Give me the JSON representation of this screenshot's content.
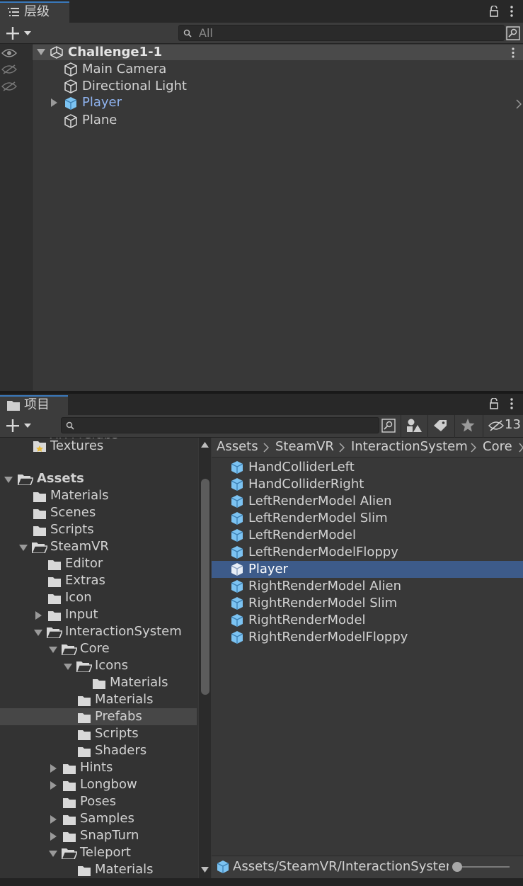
{
  "hierarchy": {
    "tab_label": "层级",
    "search_placeholder": "All",
    "scene_name": "Challenge1-1",
    "items": [
      {
        "label": "Main Camera",
        "prefab": false
      },
      {
        "label": "Directional Light",
        "prefab": false
      },
      {
        "label": "Player",
        "prefab": true
      },
      {
        "label": "Plane",
        "prefab": false
      }
    ]
  },
  "project": {
    "tab_label": "项目",
    "search_placeholder": "",
    "hidden_count": "13",
    "partial_top_label": "XR Prefabs",
    "tree": [
      {
        "label": "Textures"
      },
      {
        "label": "Assets"
      },
      {
        "label": "Materials"
      },
      {
        "label": "Scenes"
      },
      {
        "label": "Scripts"
      },
      {
        "label": "SteamVR"
      },
      {
        "label": "Editor"
      },
      {
        "label": "Extras"
      },
      {
        "label": "Icon"
      },
      {
        "label": "Input"
      },
      {
        "label": "InteractionSystem"
      },
      {
        "label": "Core"
      },
      {
        "label": "Icons"
      },
      {
        "label": "Materials"
      },
      {
        "label": "Materials"
      },
      {
        "label": "Prefabs"
      },
      {
        "label": "Scripts"
      },
      {
        "label": "Shaders"
      },
      {
        "label": "Hints"
      },
      {
        "label": "Longbow"
      },
      {
        "label": "Poses"
      },
      {
        "label": "Samples"
      },
      {
        "label": "SnapTurn"
      },
      {
        "label": "Teleport"
      },
      {
        "label": "Materials"
      }
    ],
    "breadcrumb": [
      "Assets",
      "SteamVR",
      "InteractionSystem",
      "Core"
    ],
    "assets": [
      {
        "label": "HandColliderLeft"
      },
      {
        "label": "HandColliderRight"
      },
      {
        "label": "LeftRenderModel Alien"
      },
      {
        "label": "LeftRenderModel Slim"
      },
      {
        "label": "LeftRenderModel"
      },
      {
        "label": "LeftRenderModelFloppy"
      },
      {
        "label": "Player"
      },
      {
        "label": "RightRenderModel Alien"
      },
      {
        "label": "RightRenderModel Slim"
      },
      {
        "label": "RightRenderModel"
      },
      {
        "label": "RightRenderModelFloppy"
      }
    ],
    "status_path": "Assets/SteamVR/InteractionSysten",
    "zoom": 0.0
  },
  "colors": {
    "accent": "#3a79bb",
    "selection": "#3d5b8a",
    "prefab_blue": "#7cc3f2",
    "prefab_text": "#8fb3ef"
  }
}
